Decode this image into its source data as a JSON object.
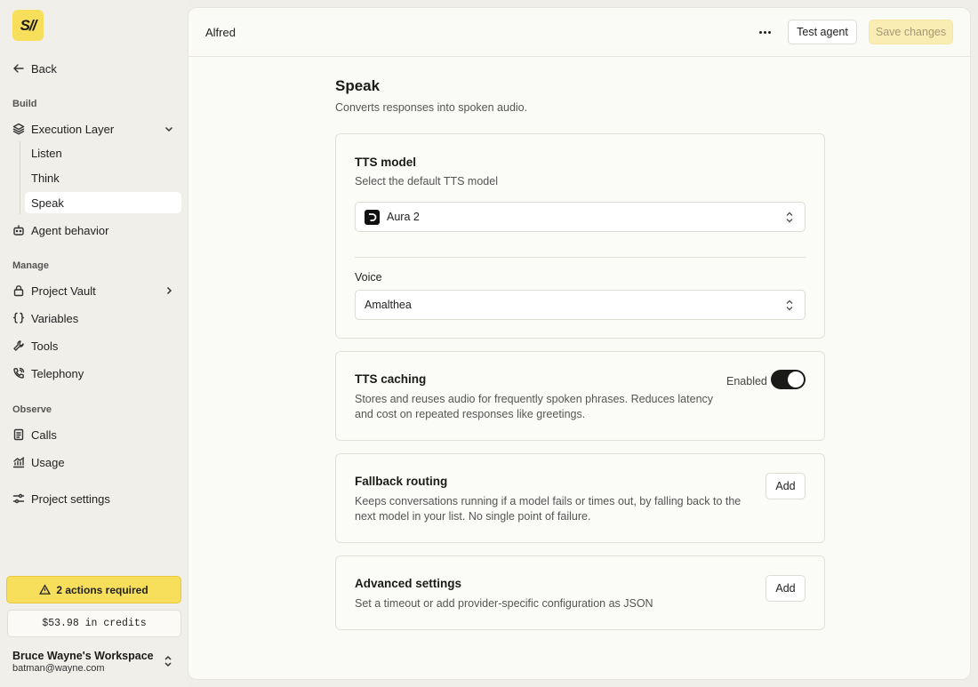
{
  "sidebar": {
    "logo": "S//",
    "back_label": "Back",
    "sections": {
      "build": "Build",
      "manage": "Manage",
      "observe": "Observe"
    },
    "items": {
      "execution_layer": "Execution Layer",
      "listen": "Listen",
      "think": "Think",
      "speak": "Speak",
      "agent_behavior": "Agent behavior",
      "project_vault": "Project Vault",
      "variables": "Variables",
      "tools": "Tools",
      "telephony": "Telephony",
      "calls": "Calls",
      "usage": "Usage",
      "project_settings": "Project settings"
    },
    "actions_required": "2 actions required",
    "credits": "$53.98 in credits",
    "workspace": {
      "name": "Bruce Wayne's Workspace",
      "email": "batman@wayne.com"
    }
  },
  "header": {
    "agent_name": "Alfred",
    "test_label": "Test agent",
    "save_label": "Save changes"
  },
  "page": {
    "title": "Speak",
    "subtitle": "Converts responses into spoken audio."
  },
  "tts_model": {
    "title": "TTS model",
    "description": "Select the default TTS model",
    "selected_model": "Aura 2",
    "voice_label": "Voice",
    "selected_voice": "Amalthea"
  },
  "tts_caching": {
    "title": "TTS caching",
    "description": "Stores and reuses audio for frequently spoken phrases. Reduces latency and cost on repeated responses like greetings.",
    "toggle_label": "Enabled",
    "enabled": true
  },
  "fallback": {
    "title": "Fallback routing",
    "description": "Keeps conversations running if a model fails or times out, by falling back to the next model in your list. No single point of failure.",
    "add_label": "Add"
  },
  "advanced": {
    "title": "Advanced settings",
    "description": "Set a timeout or add provider-specific configuration as JSON",
    "add_label": "Add"
  },
  "colors": {
    "accent": "#f8df5b",
    "background": "#efeee9",
    "panel": "#fafaf7"
  }
}
